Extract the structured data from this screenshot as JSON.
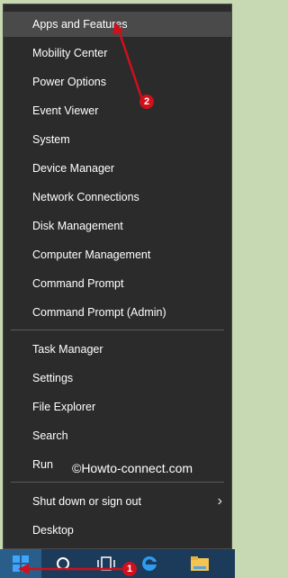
{
  "menu": {
    "items": [
      {
        "label": "Apps and Features"
      },
      {
        "label": "Mobility Center"
      },
      {
        "label": "Power Options"
      },
      {
        "label": "Event Viewer"
      },
      {
        "label": "System"
      },
      {
        "label": "Device Manager"
      },
      {
        "label": "Network Connections"
      },
      {
        "label": "Disk Management"
      },
      {
        "label": "Computer Management"
      },
      {
        "label": "Command Prompt"
      },
      {
        "label": "Command Prompt (Admin)"
      },
      {
        "label": "Task Manager"
      },
      {
        "label": "Settings"
      },
      {
        "label": "File Explorer"
      },
      {
        "label": "Search"
      },
      {
        "label": "Run"
      },
      {
        "label": "Shut down or sign out"
      },
      {
        "label": "Desktop"
      }
    ],
    "submenu_icon": "chevron-right-icon"
  },
  "watermark": "©Howto-connect.com",
  "annotations": {
    "badge1": "1",
    "badge2": "2",
    "color": "#d0101a"
  },
  "taskbar": {
    "icons": [
      "windows-start-icon",
      "search-circle-icon",
      "task-view-icon",
      "edge-browser-icon",
      "file-explorer-icon"
    ],
    "background": "#1c3a5a"
  }
}
